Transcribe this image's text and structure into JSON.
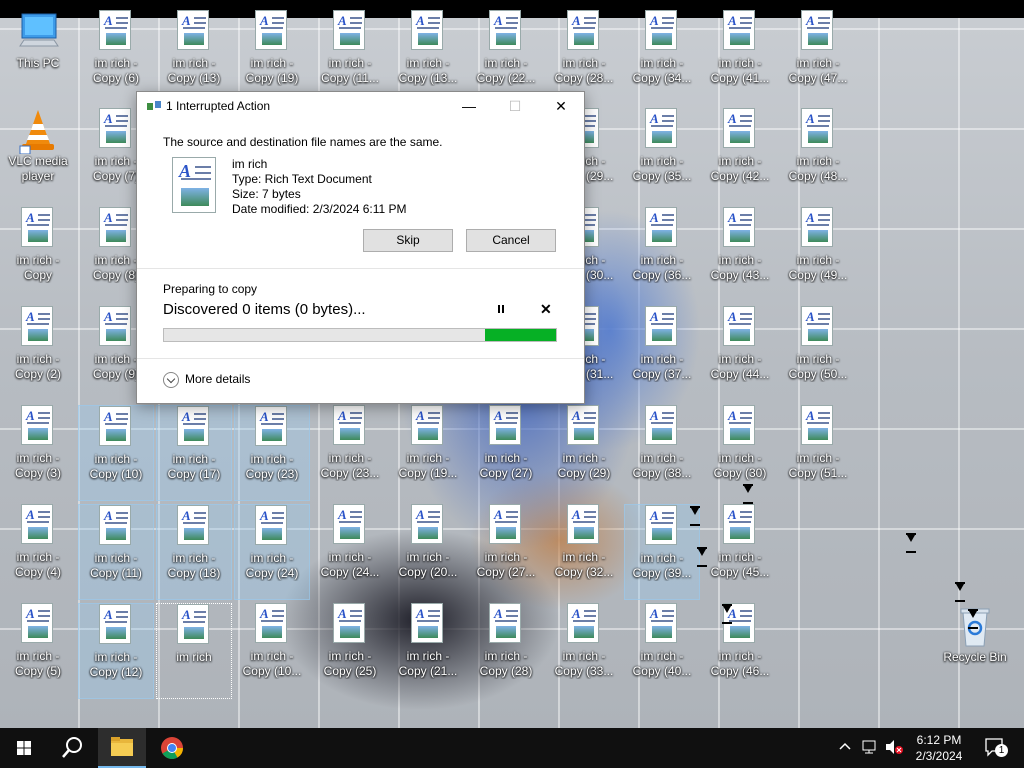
{
  "desktop": {
    "this_pc": "This PC",
    "vlc": "VLC media\nplayer",
    "recycle_bin": "Recycle Bin",
    "files": [
      {
        "col": 0,
        "row": 2,
        "l1": "im rich -",
        "l2": "Copy"
      },
      {
        "col": 0,
        "row": 3,
        "l1": "im rich -",
        "l2": "Copy (2)"
      },
      {
        "col": 0,
        "row": 4,
        "l1": "im rich -",
        "l2": "Copy (3)"
      },
      {
        "col": 0,
        "row": 5,
        "l1": "im rich -",
        "l2": "Copy (4)"
      },
      {
        "col": 0,
        "row": 6,
        "l1": "im rich -",
        "l2": "Copy (5)"
      },
      {
        "col": 1,
        "row": 0,
        "l1": "im rich -",
        "l2": "Copy (6)"
      },
      {
        "col": 1,
        "row": 1,
        "l1": "im rich -",
        "l2": "Copy (7)"
      },
      {
        "col": 1,
        "row": 2,
        "l1": "im rich -",
        "l2": "Copy (8)"
      },
      {
        "col": 1,
        "row": 3,
        "l1": "im rich -",
        "l2": "Copy (9)"
      },
      {
        "col": 1,
        "row": 4,
        "l1": "im rich -",
        "l2": "Copy (10)",
        "sel": true
      },
      {
        "col": 1,
        "row": 5,
        "l1": "im rich -",
        "l2": "Copy (11)",
        "sel": true
      },
      {
        "col": 1,
        "row": 6,
        "l1": "im rich -",
        "l2": "Copy (12)",
        "sel": true
      },
      {
        "col": 2,
        "row": 0,
        "l1": "im rich -",
        "l2": "Copy (13)"
      },
      {
        "col": 2,
        "row": 4,
        "l1": "im rich -",
        "l2": "Copy (17)",
        "sel": true
      },
      {
        "col": 2,
        "row": 5,
        "l1": "im rich -",
        "l2": "Copy (18)",
        "sel": true
      },
      {
        "col": 2,
        "row": 6,
        "l1": "im rich",
        "l2": "",
        "focus": true
      },
      {
        "col": 3,
        "row": 0,
        "l1": "im rich -",
        "l2": "Copy (19)"
      },
      {
        "col": 3,
        "row": 4,
        "l1": "im rich -",
        "l2": "Copy (23)",
        "sel": true
      },
      {
        "col": 3,
        "row": 5,
        "l1": "im rich -",
        "l2": "Copy (24)",
        "sel": true
      },
      {
        "col": 3,
        "row": 6,
        "l1": "im rich -",
        "l2": "Copy (10..."
      },
      {
        "col": 4,
        "row": 0,
        "l1": "im rich -",
        "l2": "Copy (11..."
      },
      {
        "col": 4,
        "row": 4,
        "l1": "im rich -",
        "l2": "Copy (23..."
      },
      {
        "col": 4,
        "row": 5,
        "l1": "im rich -",
        "l2": "Copy (24..."
      },
      {
        "col": 4,
        "row": 6,
        "l1": "im rich -",
        "l2": "Copy (25)"
      },
      {
        "col": 5,
        "row": 0,
        "l1": "im rich -",
        "l2": "Copy (13..."
      },
      {
        "col": 5,
        "row": 4,
        "l1": "im rich -",
        "l2": "Copy (19..."
      },
      {
        "col": 5,
        "row": 5,
        "l1": "im rich -",
        "l2": "Copy (20..."
      },
      {
        "col": 5,
        "row": 6,
        "l1": "im rich -",
        "l2": "Copy (21..."
      },
      {
        "col": 6,
        "row": 0,
        "l1": "im rich -",
        "l2": "Copy (22..."
      },
      {
        "col": 6,
        "row": 4,
        "l1": "im rich -",
        "l2": "Copy (27)"
      },
      {
        "col": 6,
        "row": 5,
        "l1": "im rich -",
        "l2": "Copy (27..."
      },
      {
        "col": 6,
        "row": 6,
        "l1": "im rich -",
        "l2": "Copy (28)"
      },
      {
        "col": 7,
        "row": 0,
        "l1": "im rich -",
        "l2": "Copy (28..."
      },
      {
        "col": 7,
        "row": 1,
        "l1": "im rich -",
        "l2": "Copy (29..."
      },
      {
        "col": 7,
        "row": 2,
        "l1": "im rich -",
        "l2": "Copy (30..."
      },
      {
        "col": 7,
        "row": 3,
        "l1": "im rich -",
        "l2": "Copy (31..."
      },
      {
        "col": 7,
        "row": 4,
        "l1": "im rich -",
        "l2": "Copy (29)"
      },
      {
        "col": 7,
        "row": 5,
        "l1": "im rich -",
        "l2": "Copy (32..."
      },
      {
        "col": 7,
        "row": 6,
        "l1": "im rich -",
        "l2": "Copy (33..."
      },
      {
        "col": 8,
        "row": 0,
        "l1": "im rich -",
        "l2": "Copy (34..."
      },
      {
        "col": 8,
        "row": 1,
        "l1": "im rich -",
        "l2": "Copy (35..."
      },
      {
        "col": 8,
        "row": 2,
        "l1": "im rich -",
        "l2": "Copy (36..."
      },
      {
        "col": 8,
        "row": 3,
        "l1": "im rich -",
        "l2": "Copy (37..."
      },
      {
        "col": 8,
        "row": 4,
        "l1": "im rich -",
        "l2": "Copy (38..."
      },
      {
        "col": 8,
        "row": 5,
        "l1": "im rich -",
        "l2": "Copy (39...",
        "sel": true
      },
      {
        "col": 8,
        "row": 6,
        "l1": "im rich -",
        "l2": "Copy (40..."
      },
      {
        "col": 9,
        "row": 0,
        "l1": "im rich -",
        "l2": "Copy (41..."
      },
      {
        "col": 9,
        "row": 1,
        "l1": "im rich -",
        "l2": "Copy (42..."
      },
      {
        "col": 9,
        "row": 2,
        "l1": "im rich -",
        "l2": "Copy (43..."
      },
      {
        "col": 9,
        "row": 3,
        "l1": "im rich -",
        "l2": "Copy (44..."
      },
      {
        "col": 9,
        "row": 4,
        "l1": "im rich -",
        "l2": "Copy (30)"
      },
      {
        "col": 9,
        "row": 5,
        "l1": "im rich -",
        "l2": "Copy (45..."
      },
      {
        "col": 9,
        "row": 6,
        "l1": "im rich -",
        "l2": "Copy (46..."
      },
      {
        "col": 10,
        "row": 0,
        "l1": "im rich -",
        "l2": "Copy (47..."
      },
      {
        "col": 10,
        "row": 1,
        "l1": "im rich -",
        "l2": "Copy (48..."
      },
      {
        "col": 10,
        "row": 2,
        "l1": "im rich -",
        "l2": "Copy (49..."
      },
      {
        "col": 10,
        "row": 3,
        "l1": "im rich -",
        "l2": "Copy (50..."
      },
      {
        "col": 10,
        "row": 4,
        "l1": "im rich -",
        "l2": "Copy (51..."
      }
    ]
  },
  "dialog": {
    "title": "1 Interrupted Action",
    "message": "The source and destination file names are the same.",
    "file_name": "im rich",
    "file_type": "Type: Rich Text Document",
    "file_size": "Size: 7 bytes",
    "file_modified": "Date modified: 2/3/2024 6:11 PM",
    "skip_label": "Skip",
    "cancel_label": "Cancel",
    "status": "Preparing to copy",
    "discovered": "Discovered 0 items (0 bytes)...",
    "progress_fraction": 0.18,
    "more_details": "More details",
    "minimize_glyph": "—",
    "maximize_glyph": "☐",
    "close_glyph": "✕",
    "stop_glyph": "✕"
  },
  "taskbar": {
    "time": "6:12 PM",
    "date": "2/3/2024",
    "notification_count": "1"
  },
  "colors": {
    "progress": "#06b025",
    "taskbar": "#101010"
  }
}
